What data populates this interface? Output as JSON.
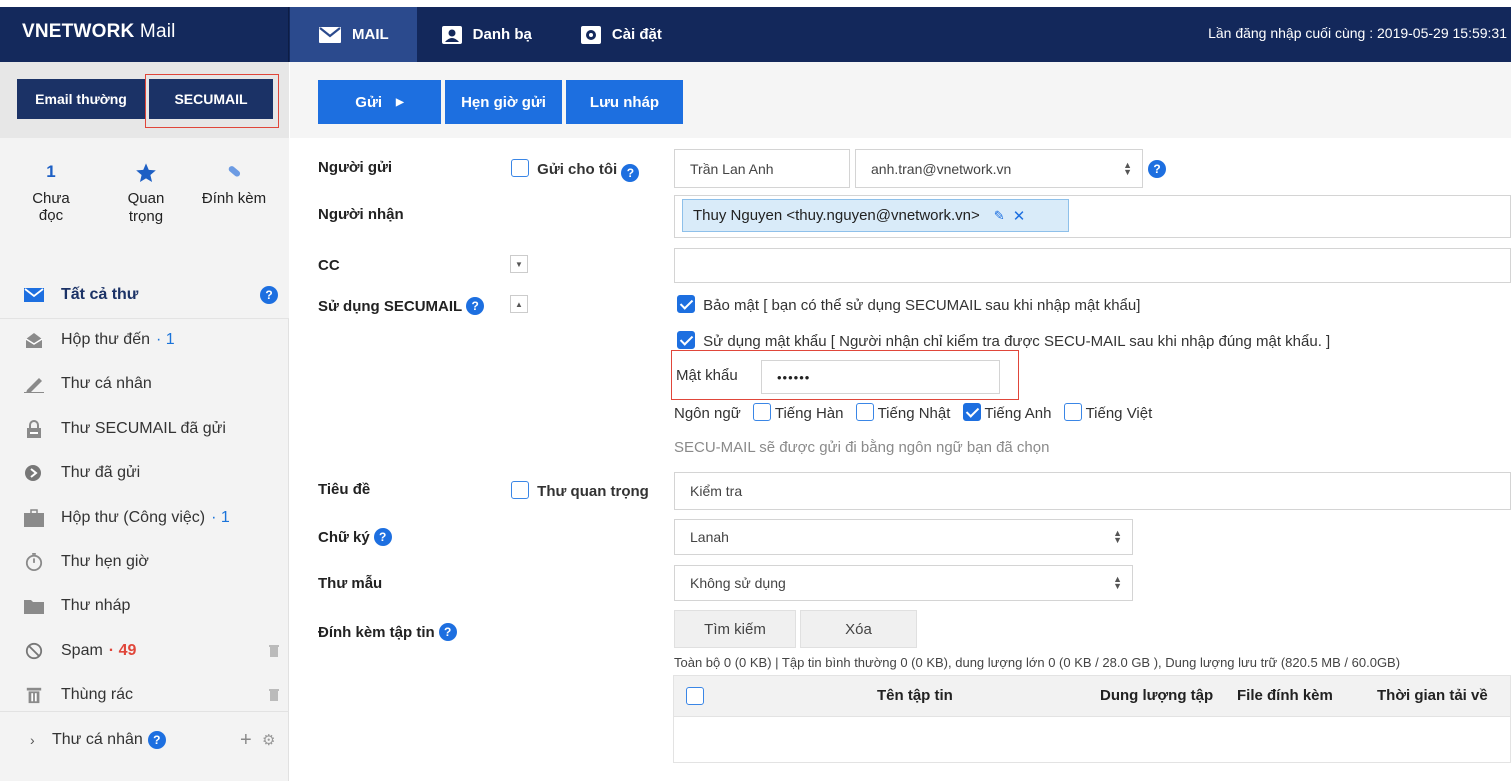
{
  "header": {
    "brand_bold": "VNETWORK",
    "brand_light": " Mail",
    "nav": [
      {
        "label": "MAIL"
      },
      {
        "label": "Danh bạ"
      },
      {
        "label": "Cài đặt"
      }
    ],
    "last_login": "Lần đăng nhập cuối cùng : 2019-05-29 15:59:31"
  },
  "sidebar": {
    "tabs": {
      "email": "Email thường",
      "secumail": "SECUMAIL"
    },
    "quick": {
      "unread_count": "1",
      "unread_label": "Chưa đọc",
      "important_label": "Quan trọng",
      "attach_label": "Đính kèm"
    },
    "folders": [
      {
        "label": "Tất cả thư",
        "count": ""
      },
      {
        "label": "Hộp thư đến",
        "count": "· 1"
      },
      {
        "label": "Thư cá nhân",
        "count": ""
      },
      {
        "label": "Thư SECUMAIL đã gửi",
        "count": ""
      },
      {
        "label": "Thư đã gửi",
        "count": ""
      },
      {
        "label": "Hộp thư (Công việc)",
        "count": "· 1"
      },
      {
        "label": "Thư hẹn giờ",
        "count": ""
      },
      {
        "label": "Thư nháp",
        "count": ""
      },
      {
        "label": "Spam",
        "count": "· 49"
      },
      {
        "label": "Thùng rác",
        "count": ""
      }
    ],
    "personal_section": "Thư cá nhân"
  },
  "toolbar": {
    "send": "Gửi",
    "schedule": "Hẹn giờ gửi",
    "draft": "Lưu nháp"
  },
  "form": {
    "sender_label": "Người gửi",
    "send_to_me_label": "Gửi cho tôi",
    "sender_name": "Trần Lan Anh",
    "sender_email": "anh.tran@vnetwork.vn",
    "recipient_label": "Người nhận",
    "recipient_chip": "Thuy Nguyen <thuy.nguyen@vnetwork.vn>",
    "cc_label": "CC",
    "cc_value": "",
    "secumail_label": "Sử dụng SECUMAIL",
    "security_option": "Bảo mật [ bạn có thể sử dụng SECUMAIL sau khi nhập mật khẩu]",
    "password_option": "Sử dụng mật khẩu [ Người nhận chỉ kiểm tra được SECU-MAIL sau khi nhập đúng mật khẩu. ]",
    "password_label": "Mật khẩu",
    "password_value": "••••••",
    "language_label": "Ngôn ngữ",
    "languages": [
      {
        "label": "Tiếng Hàn",
        "checked": false
      },
      {
        "label": "Tiếng Nhật",
        "checked": false
      },
      {
        "label": "Tiếng Anh",
        "checked": true
      },
      {
        "label": "Tiếng Việt",
        "checked": false
      }
    ],
    "language_note": "SECU-MAIL sẽ được gửi đi bằng ngôn ngữ bạn đã chọn",
    "subject_label": "Tiêu đề",
    "important_label": "Thư quan trọng",
    "subject_value": "Kiểm tra",
    "signature_label": "Chữ ký",
    "signature_value": "Lanah",
    "template_label": "Thư mẫu",
    "template_value": "Không sử dụng",
    "attach_label": "Đính kèm tập tin",
    "search_button": "Tìm kiếm",
    "delete_button": "Xóa",
    "storage_info": "Toàn bộ 0 (0 KB) | Tập tin bình thường 0 (0 KB), dung lượng lớn 0 (0 KB / 28.0 GB ), Dung lượng lưu trữ (820.5 MB / 60.0GB)",
    "table_headers": {
      "filename": "Tên tập tin",
      "size": "Dung lượng tập",
      "attached": "File đính kèm",
      "upload_time": "Thời gian tải về"
    }
  },
  "colors": {
    "navy": "#13285b",
    "accent": "#1d6fe0",
    "highlight": "#e0463a"
  }
}
